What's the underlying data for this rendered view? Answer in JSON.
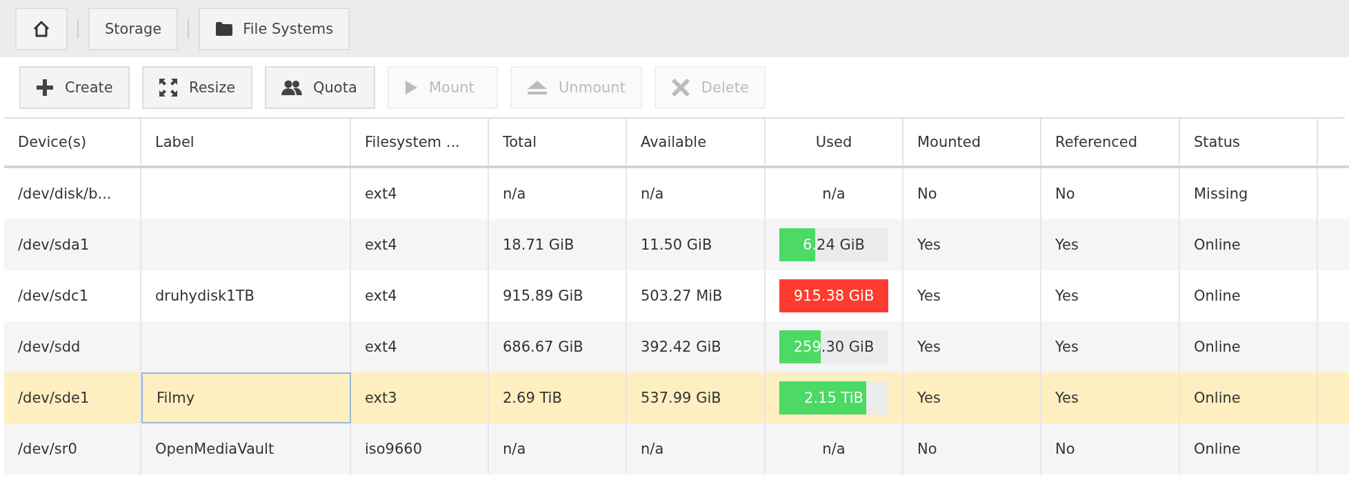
{
  "breadcrumb": [
    {
      "kind": "home"
    },
    {
      "kind": "text",
      "label": "Storage"
    },
    {
      "kind": "folder",
      "label": "File Systems"
    }
  ],
  "toolbar": [
    {
      "kind": "create",
      "label": "Create",
      "disabled": false
    },
    {
      "kind": "resize",
      "label": "Resize",
      "disabled": false
    },
    {
      "kind": "quota",
      "label": "Quota",
      "disabled": false
    },
    {
      "kind": "mount",
      "label": "Mount",
      "disabled": true
    },
    {
      "kind": "unmount",
      "label": "Unmount",
      "disabled": true
    },
    {
      "kind": "delete",
      "label": "Delete",
      "disabled": true
    }
  ],
  "table": {
    "columns": [
      "Device(s)",
      "Label",
      "Filesystem ...",
      "Total",
      "Available",
      "Used",
      "Mounted",
      "Referenced",
      "Status"
    ],
    "rows": [
      {
        "selected": false,
        "label_focused": false,
        "device": "/dev/disk/b...",
        "label": "",
        "fs": "ext4",
        "total": "n/a",
        "available": "n/a",
        "used": {
          "kind": "text",
          "text": "n/a"
        },
        "mounted": "No",
        "referenced": "No",
        "status": "Missing"
      },
      {
        "selected": false,
        "label_focused": false,
        "device": "/dev/sda1",
        "label": "",
        "fs": "ext4",
        "total": "18.71 GiB",
        "available": "11.50 GiB",
        "used": {
          "kind": "bar",
          "text": "6.24 GiB",
          "level": 0.33
        },
        "mounted": "Yes",
        "referenced": "Yes",
        "status": "Online"
      },
      {
        "selected": false,
        "label_focused": false,
        "device": "/dev/sdc1",
        "label": "druhydisk1TB",
        "fs": "ext4",
        "total": "915.89 GiB",
        "available": "503.27 MiB",
        "used": {
          "kind": "bar",
          "text": "915.38 GiB",
          "level": 1.0
        },
        "mounted": "Yes",
        "referenced": "Yes",
        "status": "Online"
      },
      {
        "selected": false,
        "label_focused": false,
        "device": "/dev/sdd",
        "label": "",
        "fs": "ext4",
        "total": "686.67 GiB",
        "available": "392.42 GiB",
        "used": {
          "kind": "bar",
          "text": "259.30 GiB",
          "level": 0.38
        },
        "mounted": "Yes",
        "referenced": "Yes",
        "status": "Online"
      },
      {
        "selected": true,
        "label_focused": true,
        "device": "/dev/sde1",
        "label": "Filmy",
        "fs": "ext3",
        "total": "2.69 TiB",
        "available": "537.99 GiB",
        "used": {
          "kind": "bar",
          "text": "2.15 TiB",
          "level": 0.8
        },
        "mounted": "Yes",
        "referenced": "Yes",
        "status": "Online"
      },
      {
        "selected": false,
        "label_focused": false,
        "device": "/dev/sr0",
        "label": "OpenMediaVault",
        "fs": "iso9660",
        "total": "n/a",
        "available": "n/a",
        "used": {
          "kind": "text",
          "text": "n/a"
        },
        "mounted": "No",
        "referenced": "No",
        "status": "Online"
      }
    ]
  }
}
